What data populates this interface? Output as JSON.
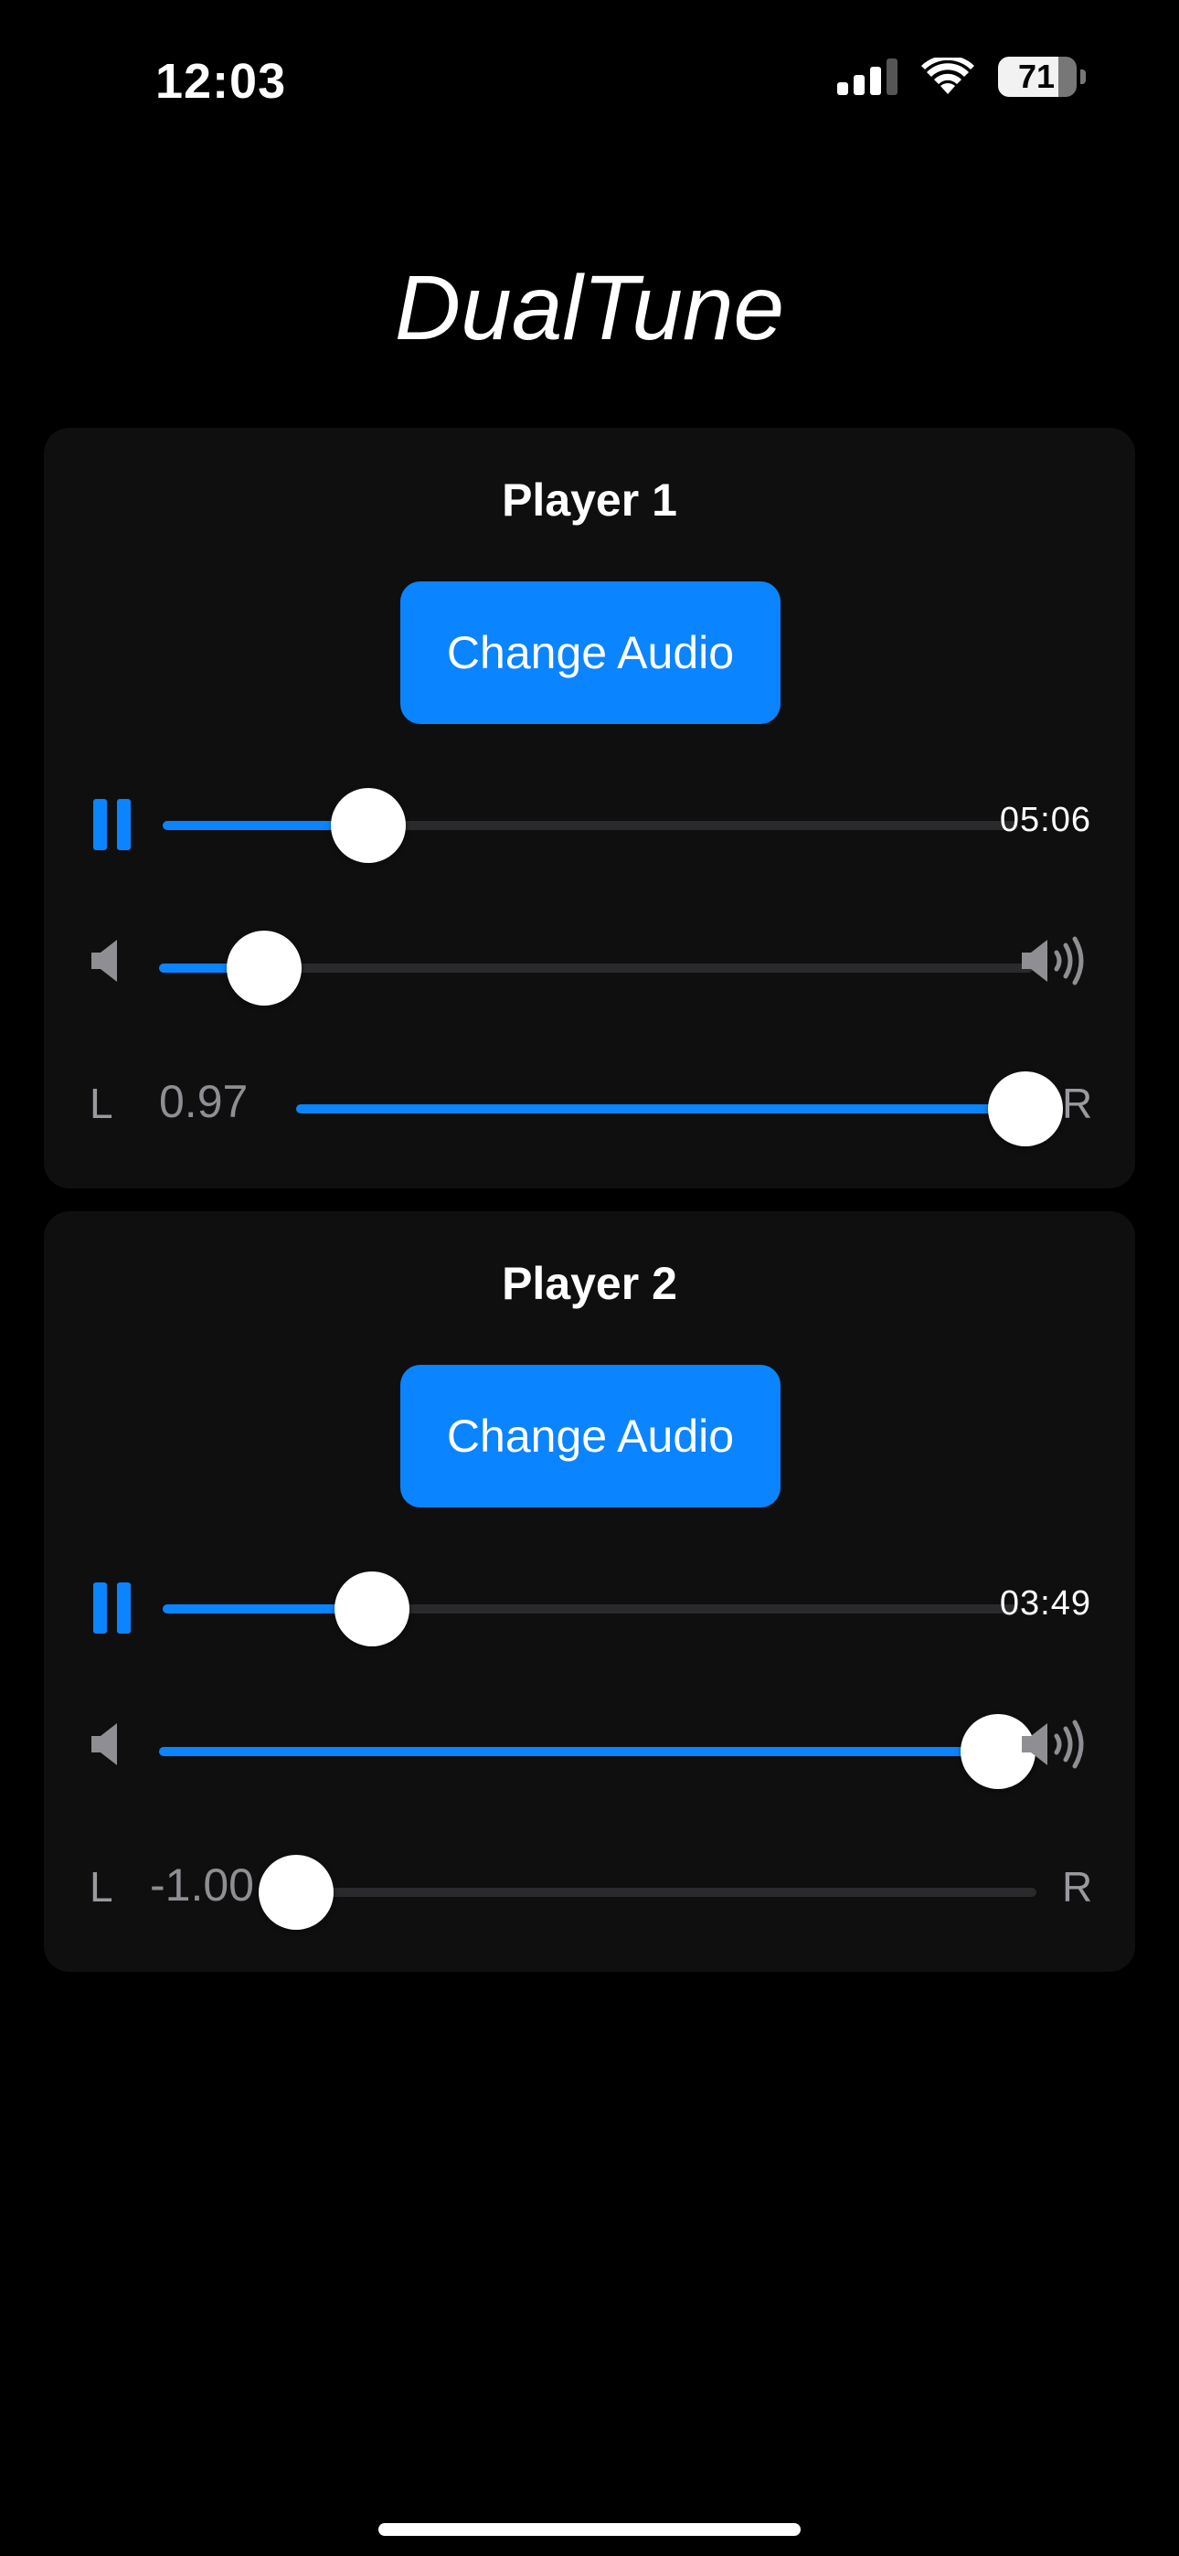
{
  "status_bar": {
    "time": "12:03",
    "battery": "71"
  },
  "app": {
    "title": "DualTune"
  },
  "players": [
    {
      "title": "Player 1",
      "change_button": "Change Audio",
      "state": "playing",
      "progress": 0.24,
      "duration": "05:06",
      "volume": 0.12,
      "pan_value": "0.97",
      "pan_left": "L",
      "pan_right": "R"
    },
    {
      "title": "Player 2",
      "change_button": "Change Audio",
      "state": "playing",
      "progress": 0.245,
      "duration": "03:49",
      "volume": 0.96,
      "pan_value": "-1.00",
      "pan_left": "L",
      "pan_right": "R"
    }
  ],
  "colors": {
    "accent": "#0b84ff",
    "background": "#000000",
    "card": "#0f0f10"
  }
}
